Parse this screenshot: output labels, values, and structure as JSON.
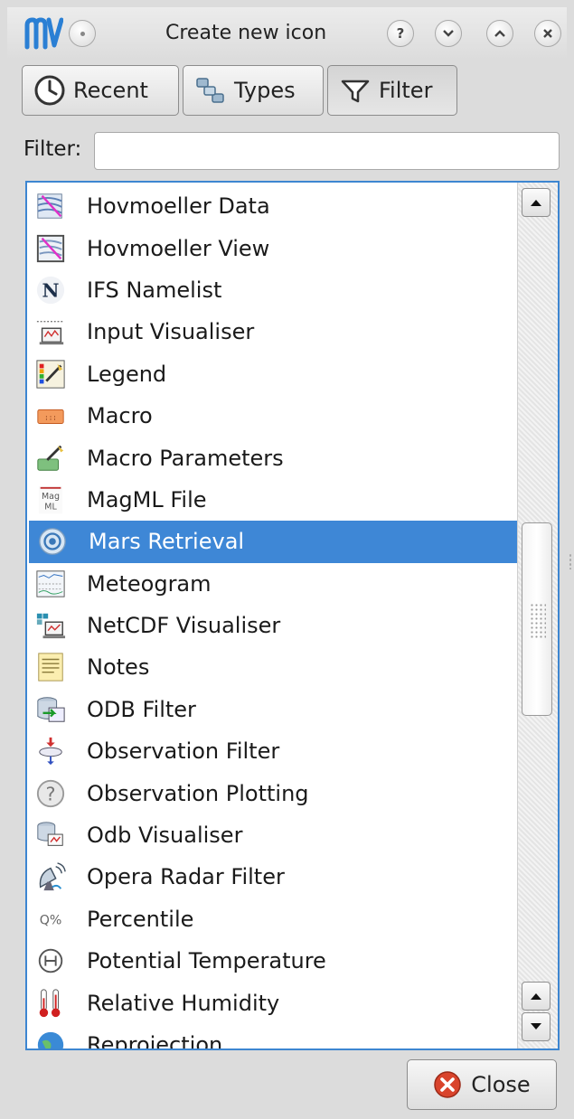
{
  "window": {
    "logo_text": "mv",
    "title": "Create new icon",
    "buttons": [
      "·",
      "?",
      "⌄",
      "⌃",
      "✕"
    ]
  },
  "tabs": [
    {
      "label": "Recent",
      "icon": "clock-icon"
    },
    {
      "label": "Types",
      "icon": "types-icon"
    },
    {
      "label": "Filter",
      "icon": "funnel-icon",
      "active": true
    }
  ],
  "filter": {
    "label": "Filter:",
    "value": "",
    "placeholder": ""
  },
  "list": {
    "selected": "Mars Retrieval",
    "items": [
      {
        "label": "Hovmoeller Data",
        "icon": "hovmoeller-data-icon"
      },
      {
        "label": "Hovmoeller View",
        "icon": "hovmoeller-view-icon"
      },
      {
        "label": "IFS Namelist",
        "icon": "namelist-n-icon",
        "glyph": "N"
      },
      {
        "label": "Input Visualiser",
        "icon": "input-visualiser-icon"
      },
      {
        "label": "Legend",
        "icon": "legend-icon"
      },
      {
        "label": "Macro",
        "icon": "macro-icon"
      },
      {
        "label": "Macro Parameters",
        "icon": "macro-parameters-icon"
      },
      {
        "label": "MagML File",
        "icon": "magml-icon",
        "glyph": "Mag ML"
      },
      {
        "label": "Mars Retrieval",
        "icon": "mars-retrieval-icon"
      },
      {
        "label": "Meteogram",
        "icon": "meteogram-icon"
      },
      {
        "label": "NetCDF Visualiser",
        "icon": "netcdf-visualiser-icon"
      },
      {
        "label": "Notes",
        "icon": "notes-icon"
      },
      {
        "label": "ODB Filter",
        "icon": "odb-filter-icon"
      },
      {
        "label": "Observation Filter",
        "icon": "observation-filter-icon"
      },
      {
        "label": "Observation Plotting",
        "icon": "question-mark-icon",
        "glyph": "?"
      },
      {
        "label": "Odb Visualiser",
        "icon": "odb-visualiser-icon"
      },
      {
        "label": "Opera Radar Filter",
        "icon": "radar-icon"
      },
      {
        "label": "Percentile",
        "icon": "percentile-icon",
        "glyph": "Q%"
      },
      {
        "label": "Potential Temperature",
        "icon": "potential-temperature-icon",
        "glyph": "H"
      },
      {
        "label": "Relative Humidity",
        "icon": "thermometer-icon"
      },
      {
        "label": "Reprojection",
        "icon": "globe-icon"
      }
    ]
  },
  "close_button": {
    "label": "Close"
  },
  "colors": {
    "selection": "#3e87d6",
    "list_border": "#3d86d1"
  }
}
